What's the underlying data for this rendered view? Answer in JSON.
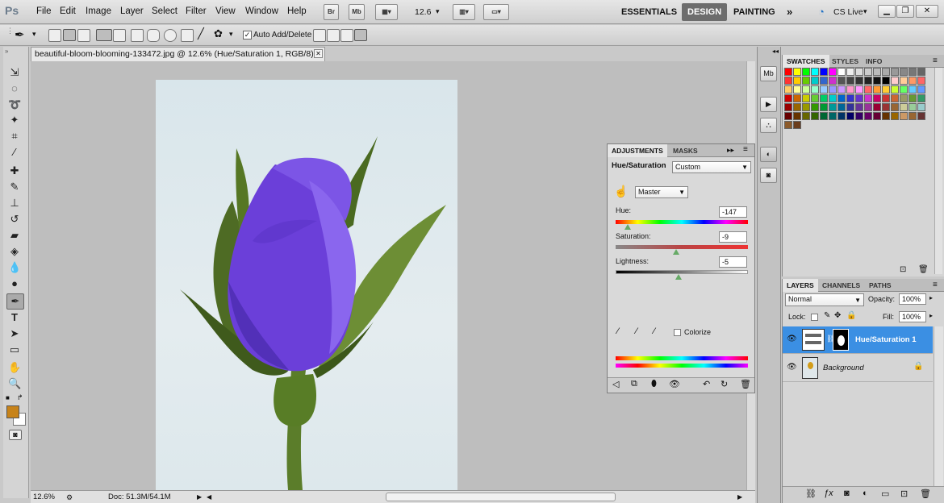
{
  "app": {
    "logo": "Ps",
    "menu": [
      "File",
      "Edit",
      "Image",
      "Layer",
      "Select",
      "Filter",
      "View",
      "Window",
      "Help"
    ],
    "bridge_label": "Br",
    "minibridge_label": "Mb",
    "zoom_value": "12.6",
    "workspaces": [
      "ESSENTIALS",
      "DESIGN",
      "PAINTING"
    ],
    "cs_live": "CS Live"
  },
  "options": {
    "auto_add_delete": "Auto Add/Delete"
  },
  "document": {
    "tab_title": "beautiful-bloom-blooming-133472.jpg @ 12.6% (Hue/Saturation 1, RGB/8) *",
    "zoom_status": "12.6%",
    "doc_size": "Doc: 51.3M/54.1M"
  },
  "adjustments": {
    "tabs": [
      "ADJUSTMENTS",
      "MASKS"
    ],
    "title": "Hue/Saturation",
    "preset": "Custom",
    "channel": "Master",
    "hue_label": "Hue:",
    "hue_value": "-147",
    "saturation_label": "Saturation:",
    "saturation_value": "-9",
    "lightness_label": "Lightness:",
    "lightness_value": "-5",
    "colorize_label": "Colorize",
    "hue_level": 0.09,
    "saturation_level": 0.455,
    "lightness_level": 0.475
  },
  "swatches_panel": {
    "tabs": [
      "SWATCHES",
      "STYLES",
      "INFO"
    ]
  },
  "layers_panel": {
    "tabs": [
      "LAYERS",
      "CHANNELS",
      "PATHS"
    ],
    "blend_mode": "Normal",
    "opacity_label": "Opacity:",
    "opacity_value": "100%",
    "lock_label": "Lock:",
    "fill_label": "Fill:",
    "fill_value": "100%",
    "layers": [
      {
        "name": "Hue/Saturation 1",
        "selected": true
      },
      {
        "name": "Background",
        "selected": false
      }
    ]
  },
  "colors": {
    "foreground": "#c7831a",
    "background": "#ffffff",
    "selection_blue": "#3b8fe3"
  }
}
